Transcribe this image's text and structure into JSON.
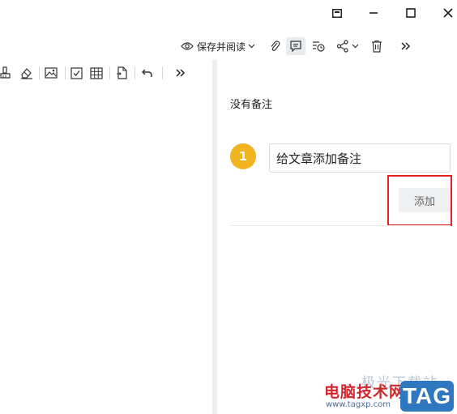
{
  "window": {
    "controls": [
      {
        "name": "restore-window-icon"
      },
      {
        "name": "minimize-icon"
      },
      {
        "name": "maximize-icon"
      },
      {
        "name": "close-icon"
      }
    ]
  },
  "toolbar_right": {
    "save_read_label": "保存并阅读",
    "icons": [
      "eye-icon",
      "chevron-down-icon",
      "attachment-icon",
      "comment-icon",
      "history-icon",
      "share-icon",
      "delete-icon",
      "more-icon"
    ]
  },
  "editor_toolbar": {
    "icons": [
      "format-painter-icon",
      "eraser-icon",
      "image-icon",
      "checkbox-icon",
      "table-icon",
      "insert-file-icon",
      "undo-icon",
      "more-icon"
    ]
  },
  "notes_panel": {
    "empty_text": "没有备注",
    "step_number": "1",
    "note_input_value": "给文章添加备注",
    "add_button_label": "添加"
  },
  "watermark": {
    "site_name": "电脑技术网",
    "url": "www.tagxp.com",
    "tag": "TAG",
    "faint_text": "极光下载站"
  },
  "colors": {
    "badge": "#f0b41f",
    "highlight": "#e32222",
    "tag_blue": "#2f78bf"
  }
}
